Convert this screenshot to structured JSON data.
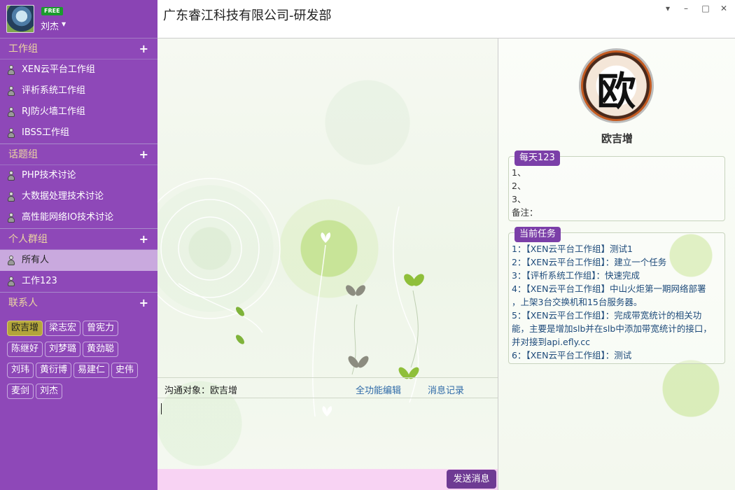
{
  "user": {
    "name": "刘杰",
    "badge": "FREE"
  },
  "window": {
    "title": "广东睿江科技有限公司-研发部"
  },
  "groups": [
    {
      "title": "工作组",
      "items": [
        "XEN云平台工作组",
        "评析系统工作组",
        "RJ防火墙工作组",
        "IBSS工作组"
      ]
    },
    {
      "title": "话题组",
      "items": [
        "PHP技术讨论",
        "大数据处理技术讨论",
        "高性能网络IO技术讨论"
      ]
    },
    {
      "title": "个人群组",
      "items": [
        "所有人",
        "工作123"
      ]
    }
  ],
  "contacts_title": "联系人",
  "contacts": [
    "欧吉增",
    "梁志宏",
    "曾宪力",
    "陈继好",
    "刘梦璐",
    "黄劲聪",
    "刘玮",
    "黄衍博",
    "易建仁",
    "史伟",
    "麦剑",
    "刘杰"
  ],
  "chat": {
    "target_label": "沟通对象：欧吉增",
    "full_edit_label": "全功能编辑",
    "history_label": "消息记录",
    "send_label": "发送消息",
    "input_value": ""
  },
  "profile": {
    "avatar_glyph": "欧",
    "name": "欧吉增"
  },
  "daily": {
    "tag": "每天123",
    "lines": [
      "1、",
      "2、",
      "3、",
      "备注："
    ]
  },
  "tasks": {
    "tag": "当前任务",
    "lines": [
      "1：【XEN云平台工作组】测试1",
      "2：【XEN云平台工作组】：建立一个任务",
      "3：【评析系统工作组】：快速完成",
      "4：【XEN云平台工作组】中山火炬第一期网络部署",
      "，上架3台交换机和15台服务器。",
      "5：【XEN云平台工作组】：完成带宽统计的相关功",
      "能，主要是增加slb并在slb中添加带宽统计的接口，",
      "并对接到api.efly.cc",
      "6：【XEN云平台工作组】：测试"
    ]
  },
  "colors": {
    "sidebar": "#8e48b8",
    "accent": "#7b3fa8",
    "selected_contact": "#b3a53a",
    "send_bar": "#f8d3f3"
  },
  "icons": {
    "group_item": "person-icon",
    "add": "plus-icon",
    "user_menu": "caret-down-icon"
  }
}
